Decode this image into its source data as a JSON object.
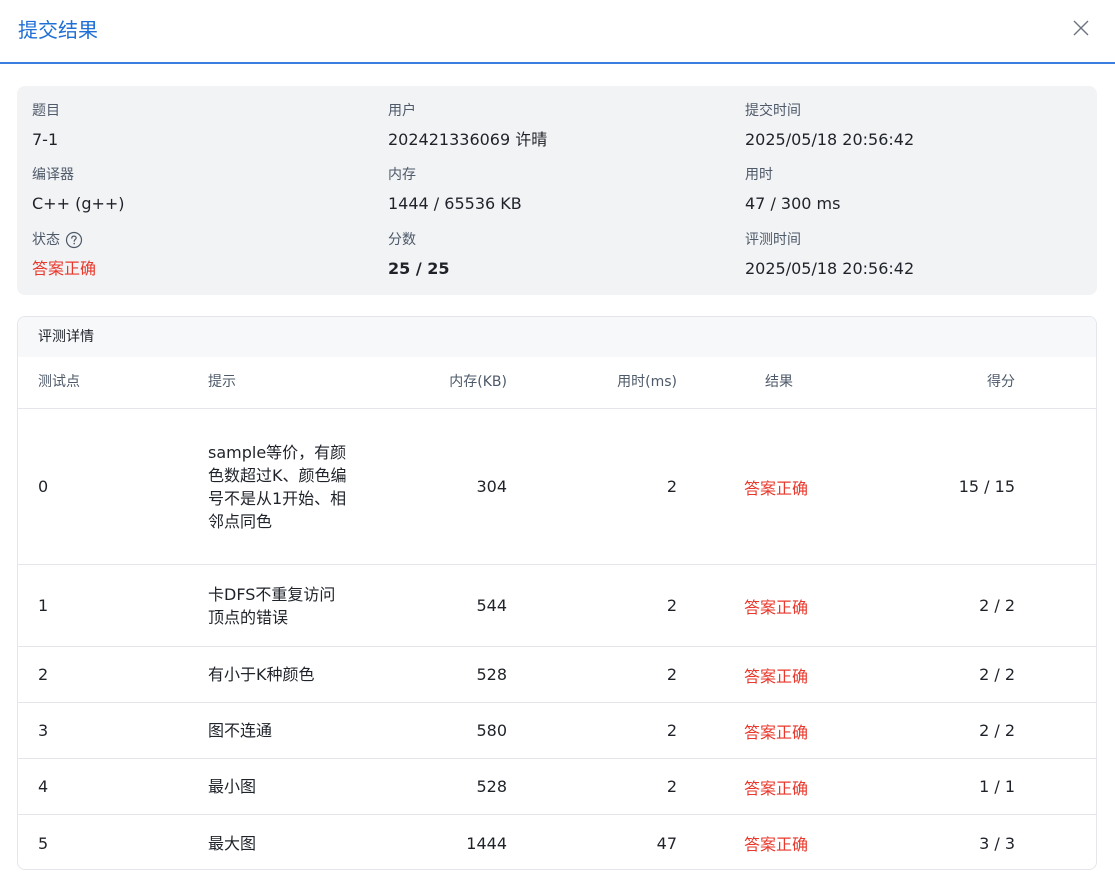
{
  "dialog": {
    "title": "提交结果"
  },
  "summary": {
    "problem": {
      "label": "题目",
      "value": "7-1"
    },
    "user": {
      "label": "用户",
      "value": "202421336069 许晴"
    },
    "submit_time": {
      "label": "提交时间",
      "value": "2025/05/18 20:56:42"
    },
    "compiler": {
      "label": "编译器",
      "value": "C++ (g++)"
    },
    "memory": {
      "label": "内存",
      "value": "1444 / 65536 KB"
    },
    "time_used": {
      "label": "用时",
      "value": "47 / 300 ms"
    },
    "status": {
      "label": "状态",
      "value": "答案正确",
      "icon": "help-circle-icon"
    },
    "score": {
      "label": "分数",
      "value": "25 / 25"
    },
    "judge_time": {
      "label": "评测时间",
      "value": "2025/05/18 20:56:42"
    }
  },
  "details": {
    "title": "评测详情",
    "columns": [
      "测试点",
      "提示",
      "内存(KB)",
      "用时(ms)",
      "结果",
      "得分"
    ],
    "rows": [
      {
        "id": "0",
        "hint": "sample等价，有颜色数超过K、颜色编号不是从1开始、相邻点同色",
        "memory": "304",
        "time": "2",
        "result": "答案正确",
        "score": "15 / 15"
      },
      {
        "id": "1",
        "hint": "卡DFS不重复访问顶点的错误",
        "memory": "544",
        "time": "2",
        "result": "答案正确",
        "score": "2 / 2"
      },
      {
        "id": "2",
        "hint": "有小于K种颜色",
        "memory": "528",
        "time": "2",
        "result": "答案正确",
        "score": "2 / 2"
      },
      {
        "id": "3",
        "hint": "图不连通",
        "memory": "580",
        "time": "2",
        "result": "答案正确",
        "score": "2 / 2"
      },
      {
        "id": "4",
        "hint": "最小图",
        "memory": "528",
        "time": "2",
        "result": "答案正确",
        "score": "1 / 1"
      },
      {
        "id": "5",
        "hint": "最大图",
        "memory": "1444",
        "time": "47",
        "result": "答案正确",
        "score": "3 / 3"
      }
    ]
  },
  "colors": {
    "accent": "#1f6fd6",
    "success_text": "#e8372b"
  }
}
